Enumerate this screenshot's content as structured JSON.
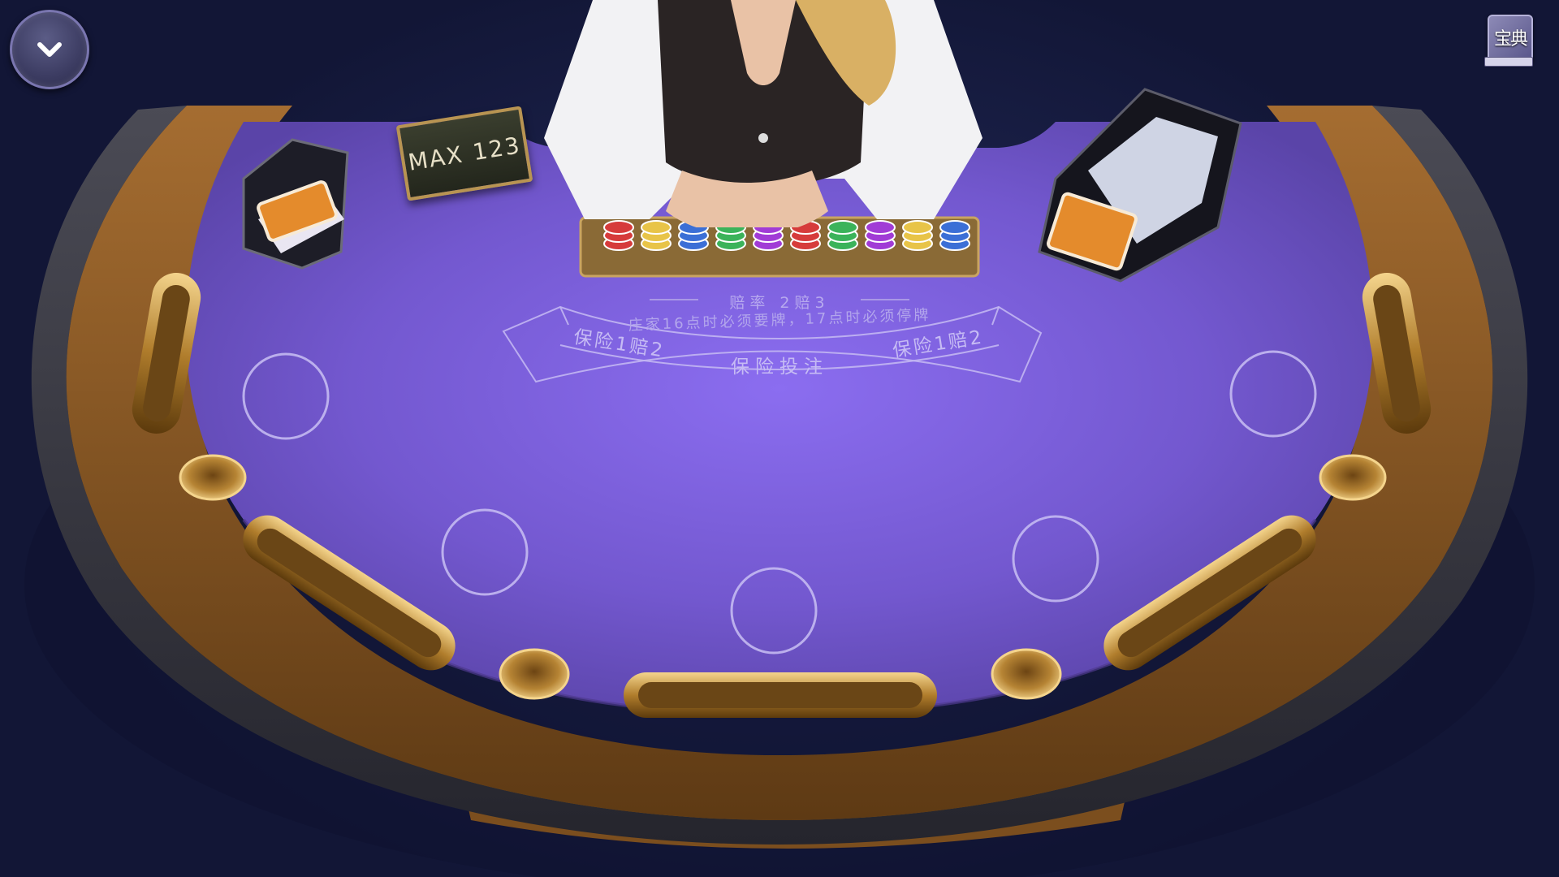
{
  "menu": {
    "icon": "chevron-down-icon"
  },
  "rulebook": {
    "label": "宝典",
    "icon": "book-icon"
  },
  "table": {
    "max_label": "MAX",
    "max_value": "123",
    "odds_label": "赔率 2赔3",
    "dealer_rule": "庄家16点时必须要牌，17点时必须停牌",
    "insurance_left": "保险1赔2",
    "insurance_center": "保险投注",
    "insurance_right": "保险1赔2",
    "felt_color": "#8066e0",
    "rail_color": "#3a3a44",
    "wood_color": "#8a5a26"
  }
}
